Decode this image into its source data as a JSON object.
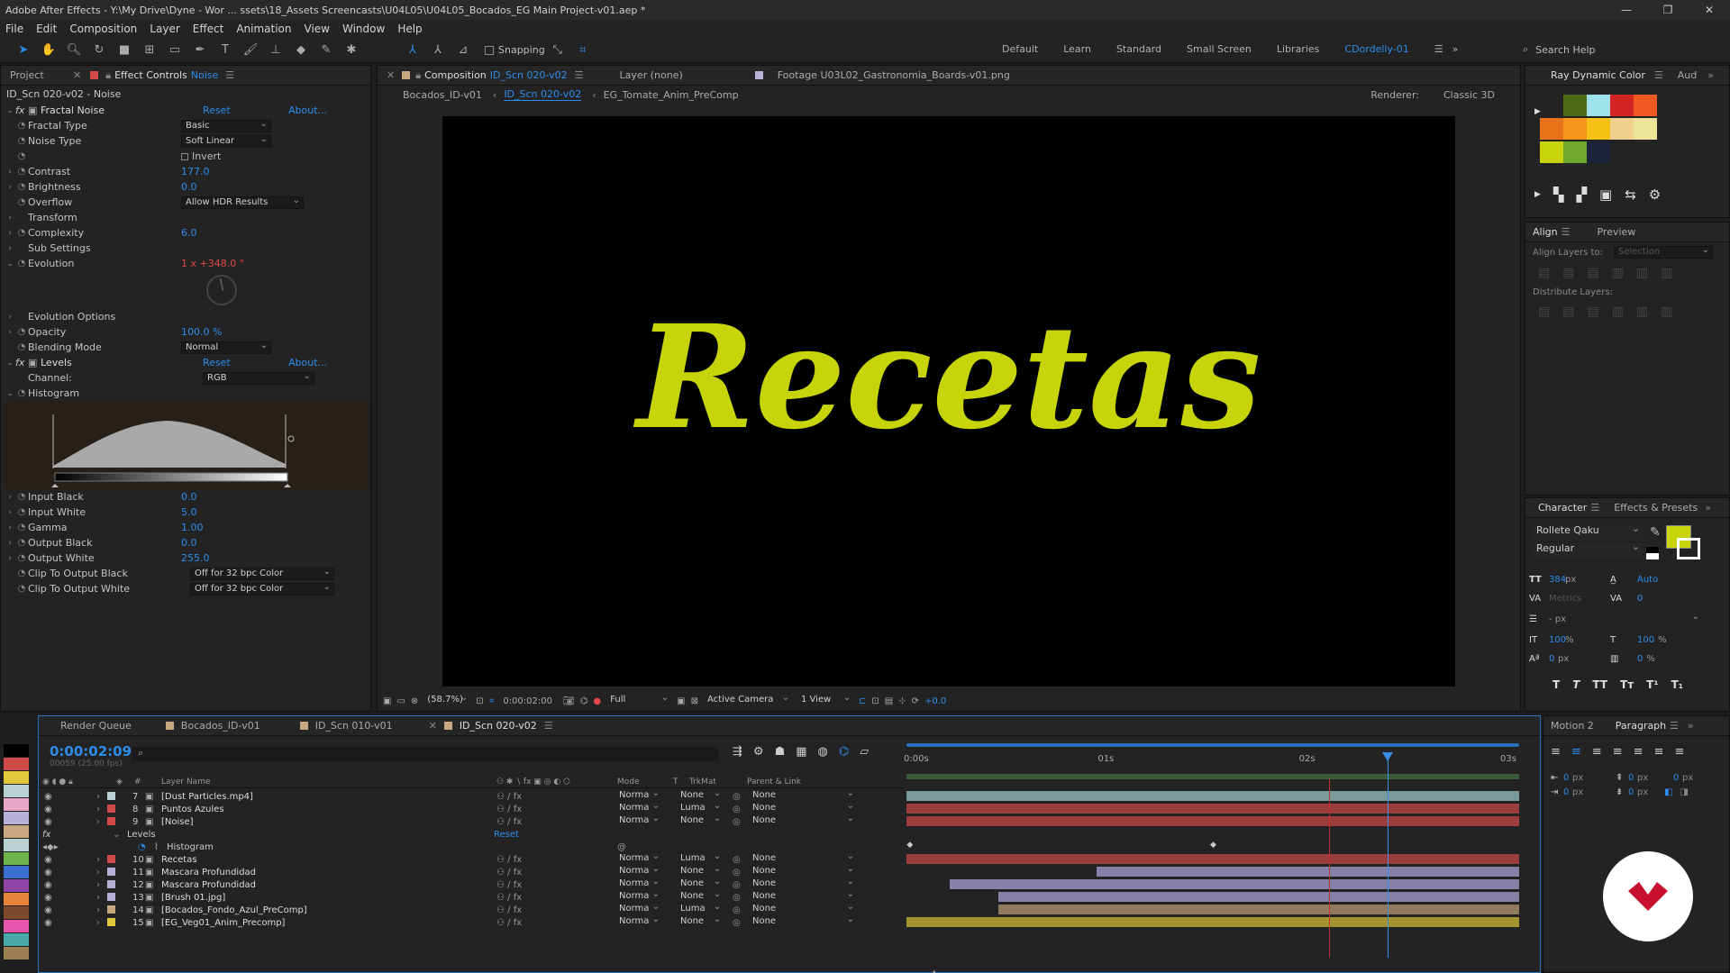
{
  "window": {
    "title": "Adobe After Effects - Y:\\My Drive\\Dyne - Wor ... ssets\\18_Assets Screencasts\\U04L05\\U04L05_Bocados_EG Main Project-v01.aep *",
    "min": "—",
    "max": "❐",
    "close": "✕"
  },
  "menu": [
    "File",
    "Edit",
    "Composition",
    "Layer",
    "Effect",
    "Animation",
    "View",
    "Window",
    "Help"
  ],
  "toolbar": {
    "snapping": "Snapping",
    "search_placeholder": "Search Help",
    "workspaces": [
      "Default",
      "Learn",
      "Standard",
      "Small Screen",
      "Libraries",
      "CDordelly-01"
    ],
    "more": "»"
  },
  "left_panel": {
    "tab_project": "Project",
    "tab_effect_controls": "Effect Controls",
    "tab_effect_layer": "Noise",
    "breadcrumb": "ID_Scn 020-v02 - Noise",
    "fractal": {
      "name": "Fractal Noise",
      "reset": "Reset",
      "about": "About...",
      "props": [
        {
          "label": "Fractal Type",
          "type": "dropdown",
          "value": "Basic"
        },
        {
          "label": "Noise Type",
          "type": "dropdown",
          "value": "Soft Linear"
        },
        {
          "label": "",
          "type": "checkbox",
          "value": "Invert"
        },
        {
          "label": "Contrast",
          "type": "value",
          "value": "177.0"
        },
        {
          "label": "Brightness",
          "type": "value",
          "value": "0.0"
        },
        {
          "label": "Overflow",
          "type": "dropdown",
          "value": "Allow HDR Results"
        },
        {
          "label": "Transform",
          "type": "group",
          "value": ""
        },
        {
          "label": "Complexity",
          "type": "value",
          "value": "6.0"
        },
        {
          "label": "Sub Settings",
          "type": "group",
          "value": ""
        },
        {
          "label": "Evolution",
          "type": "red",
          "value": "1 x +348.0 °"
        }
      ],
      "props2": [
        {
          "label": "Evolution Options",
          "type": "group",
          "value": ""
        },
        {
          "label": "Opacity",
          "type": "value",
          "value": "100.0 %"
        },
        {
          "label": "Blending Mode",
          "type": "dropdown",
          "value": "Normal"
        }
      ]
    },
    "levels": {
      "name": "Levels",
      "reset": "Reset",
      "about": "About...",
      "channel_label": "Channel:",
      "channel": "RGB",
      "histogram": "Histogram",
      "props": [
        {
          "label": "Input Black",
          "value": "0.0"
        },
        {
          "label": "Input White",
          "value": "5.0"
        },
        {
          "label": "Gamma",
          "value": "1.00"
        },
        {
          "label": "Output Black",
          "value": "0.0"
        },
        {
          "label": "Output White",
          "value": "255.0"
        }
      ],
      "clip_black_label": "Clip To Output Black",
      "clip_black": "Off for 32 bpc Color",
      "clip_white_label": "Clip To Output White",
      "clip_white": "Off for 32 bpc Color"
    }
  },
  "viewer": {
    "tab_composition": "Composition",
    "comp_name": "ID_Scn 020-v02",
    "tab_layer": "Layer (none)",
    "tab_footage": "Footage U03L02_Gastronomia_Boards-v01.png",
    "flow": [
      "Bocados_ID-v01",
      "ID_Scn 020-v02",
      "EG_Tomate_Anim_PreComp"
    ],
    "renderer_label": "Renderer:",
    "renderer": "Classic 3D",
    "canvas_text": "Recetas",
    "footer": {
      "zoom": "(58.7%)",
      "time": "0:00:02:00",
      "resolution": "Full",
      "camera": "Active Camera",
      "views": "1 View",
      "exposure": "+0.0"
    }
  },
  "right_panel": {
    "color_tab": "Ray Dynamic Color",
    "aud_tab": "Aud",
    "align_tab": "Align",
    "preview_tab": "Preview",
    "align_layers_to": "Align Layers to:",
    "align_target": "Selection",
    "distribute": "Distribute Layers:",
    "character_tab": "Character",
    "effects_tab": "Effects & Presets",
    "font": "Rollete Qaku",
    "style": "Regular",
    "size": "384",
    "size_unit": "px",
    "leading": "Auto",
    "kerning": "Metrics",
    "tracking": "0",
    "stroke_unit": "- px",
    "vscale": "100",
    "hscale": "100",
    "baseline": "0",
    "tsume": "0",
    "pct": "%",
    "px": "px",
    "typo_buttons": [
      "T",
      "T",
      "TT",
      "Tт",
      "T¹",
      "T₁"
    ],
    "fill_color": "#c8d40a",
    "colors": [
      "#4b6a13",
      "#9fe1ea",
      "#d22422",
      "#f05a23",
      "#e8731a",
      "#f5951b",
      "#f4c114",
      "#efd08c",
      "#efe59a",
      "#c8d40a",
      "#6fa82a",
      "#1b2438"
    ]
  },
  "bottom_right": {
    "motion_tab": "Motion 2",
    "paragraph_tab": "Paragraph",
    "zero": "0",
    "px": "px"
  },
  "timeline": {
    "tabs": [
      "Render Queue",
      "Bocados_ID-v01",
      "ID_Scn 010-v01",
      "ID_Scn 020-v02"
    ],
    "timecode": "0:00:02:09",
    "frames": "00059 (25.00 fps)",
    "headers": {
      "num": "#",
      "name": "Layer Name",
      "mode": "Mode",
      "t": "T",
      "trkmat": "TrkMat",
      "parent": "Parent & Link"
    },
    "ruler": [
      "0:00s",
      "01s",
      "02s",
      "03s"
    ],
    "layers": [
      {
        "num": "7",
        "name": "[Dust Particles.mp4]",
        "color": "#b9d3d3",
        "mode": "Norma",
        "trk": "None",
        "parent": "None",
        "bar": "#7a9a9a",
        "start": 0.0
      },
      {
        "num": "8",
        "name": "Puntos Azules",
        "color": "#d14a4a",
        "mode": "Norma",
        "trk": "Luma",
        "parent": "None",
        "bar": "#9d3e3e",
        "start": 0.0
      },
      {
        "num": "9",
        "name": "[Noise]",
        "color": "#d14a4a",
        "mode": "Norma",
        "trk": "None",
        "parent": "None",
        "bar": "#9d3e3e",
        "start": 0.0
      },
      {
        "num": "",
        "name": "Levels",
        "color": "",
        "mode": "",
        "trk": "",
        "parent": "",
        "bar": "",
        "start": 0.0,
        "reset": "Reset"
      },
      {
        "num": "",
        "name": "Histogram",
        "color": "",
        "mode": "",
        "trk": "",
        "parent": "",
        "bar": "",
        "start": 0.0
      },
      {
        "num": "10",
        "name": "Recetas",
        "color": "#d14a4a",
        "mode": "Norma",
        "trk": "Luma",
        "parent": "None",
        "bar": "#9d3e3e",
        "start": 0.0
      },
      {
        "num": "11",
        "name": "Mascara Profundidad",
        "color": "#b7b1d8",
        "mode": "Norma",
        "trk": "None",
        "parent": "None",
        "bar": "#8580a6",
        "start": 0.31
      },
      {
        "num": "12",
        "name": "Mascara Profundidad",
        "color": "#b7b1d8",
        "mode": "Norma",
        "trk": "None",
        "parent": "None",
        "bar": "#8580a6",
        "start": 0.07
      },
      {
        "num": "13",
        "name": "[Brush 01.jpg]",
        "color": "#b7b1d8",
        "mode": "Norma",
        "trk": "None",
        "parent": "None",
        "bar": "#8580a6",
        "start": 0.15
      },
      {
        "num": "14",
        "name": "[Bocados_Fondo_Azul_PreComp]",
        "color": "#c7a880",
        "mode": "Norma",
        "trk": "Luma",
        "parent": "None",
        "bar": "#8f7a5e",
        "start": 0.15
      },
      {
        "num": "15",
        "name": "[EG_Veg01_Anim_Precomp]",
        "color": "#e1c83b",
        "mode": "Norma",
        "trk": "None",
        "parent": "None",
        "bar": "#a39330",
        "start": 0.0
      }
    ],
    "playhead": 0.785
  },
  "label_colors": [
    "#000000",
    "#d14a4a",
    "#e1c83b",
    "#b9d3d3",
    "#e8a7c8",
    "#b7b1d8",
    "#c7a880",
    "#b9d3d3",
    "#6eb44c",
    "#3c6fd1",
    "#8f44a7",
    "#e6833a",
    "#7e4a2e",
    "#e754ae",
    "#49a8a8",
    "#9b8052"
  ]
}
